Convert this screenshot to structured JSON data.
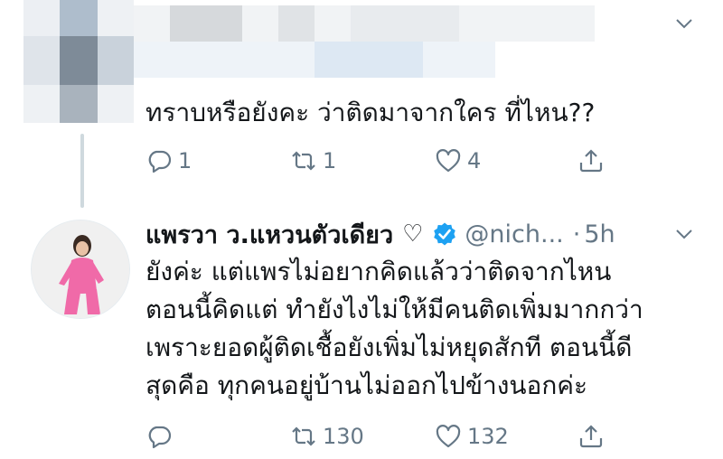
{
  "first_tweet": {
    "text": "ทราบหรือยังคะ ว่าติดมาจากใคร ที่ไหน??",
    "actions": {
      "reply_count": "1",
      "retweet_count": "1",
      "like_count": "4"
    }
  },
  "second_tweet": {
    "display_name": "แพรวา ว.แหวนตัวเดียว",
    "name_emoji": "♡",
    "handle": "@nich...",
    "separator": "·",
    "time": "5h",
    "lines": [
      "ยังค่ะ แต่แพรไม่อยากคิดแล้วว่าติดจากไหน",
      "ตอนนี้คิดแต่ ทำยังไงไม่ให้มีคนติดเพิ่มมากกว่า",
      "เพราะยอดผู้ติดเชื้อยังเพิ่มไม่หยุดสักที ตอนนี้ดี",
      "สุดคือ ทุกคนอยู่บ้านไม่ออกไปข้างนอกค่ะ"
    ],
    "actions": {
      "reply_count": "",
      "retweet_count": "130",
      "like_count": "132"
    }
  },
  "colors": {
    "text": "#14171a",
    "muted": "#657786",
    "verified_blue": "#1da1f2",
    "thread_line": "#cfd9de"
  },
  "icons": [
    "reply-icon",
    "retweet-icon",
    "like-icon",
    "share-icon",
    "verified-badge-icon",
    "chevron-down-icon"
  ]
}
